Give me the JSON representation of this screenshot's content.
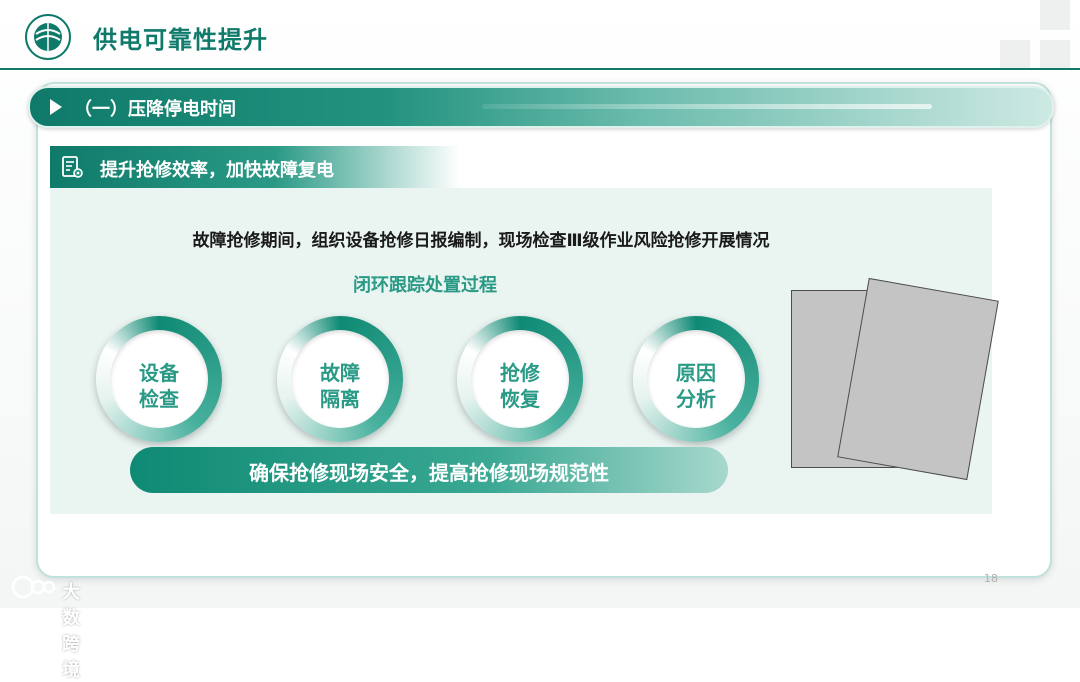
{
  "header": {
    "title": "供电可靠性提升"
  },
  "section": {
    "label": "（一）压降停电时间"
  },
  "subsection": {
    "label": "提升抢修效率，加快故障复电"
  },
  "main": {
    "headline": "故障抢修期间，组织设备抢修日报编制，现场检查Ⅲ级作业风险抢修开展情况",
    "loop_title": "闭环跟踪处置过程",
    "steps": [
      {
        "line1": "设备",
        "line2": "检查"
      },
      {
        "line1": "故障",
        "line2": "隔离"
      },
      {
        "line1": "抢修",
        "line2": "恢复"
      },
      {
        "line1": "原因",
        "line2": "分析"
      }
    ],
    "banner": "确保抢修现场安全，提高抢修现场规范性"
  },
  "footer": {
    "page_number": "18",
    "watermark": "大数跨境"
  },
  "colors": {
    "accent": "#0f7a6a",
    "accent_light": "#2a9a86",
    "panel": "#eaf5f2"
  },
  "icons": {
    "logo": "state-grid-logo",
    "sub_icon": "document-gear-icon",
    "section_icon": "play-triangle-icon"
  }
}
